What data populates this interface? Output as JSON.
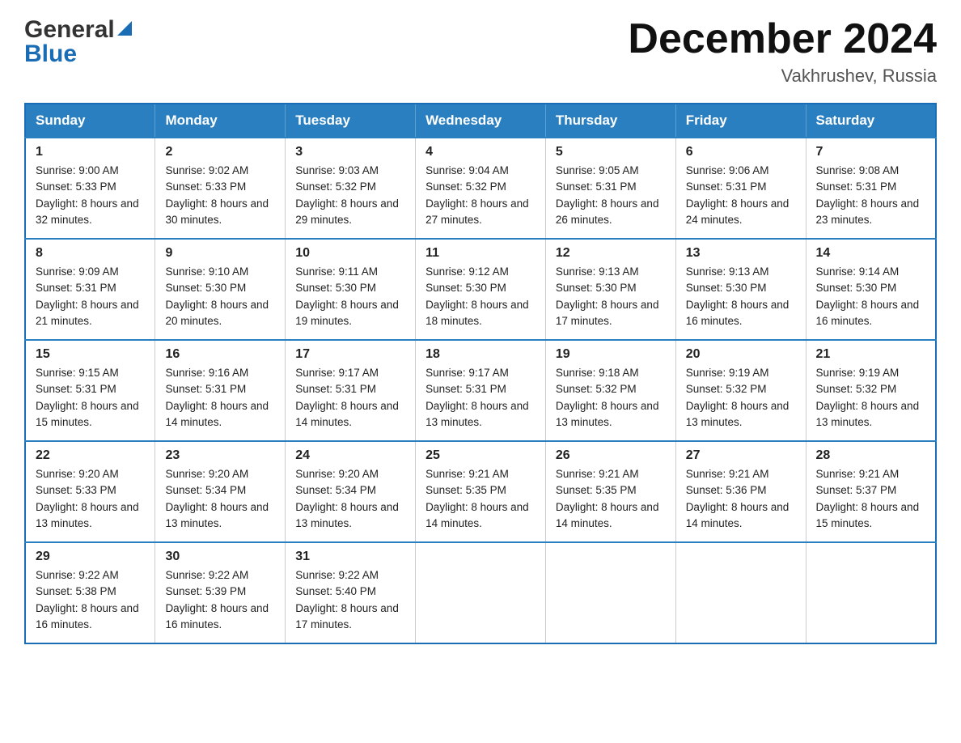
{
  "header": {
    "logo_general": "General",
    "logo_blue": "Blue",
    "title": "December 2024",
    "subtitle": "Vakhrushev, Russia"
  },
  "columns": [
    "Sunday",
    "Monday",
    "Tuesday",
    "Wednesday",
    "Thursday",
    "Friday",
    "Saturday"
  ],
  "weeks": [
    [
      {
        "day": "1",
        "sunrise": "Sunrise: 9:00 AM",
        "sunset": "Sunset: 5:33 PM",
        "daylight": "Daylight: 8 hours and 32 minutes."
      },
      {
        "day": "2",
        "sunrise": "Sunrise: 9:02 AM",
        "sunset": "Sunset: 5:33 PM",
        "daylight": "Daylight: 8 hours and 30 minutes."
      },
      {
        "day": "3",
        "sunrise": "Sunrise: 9:03 AM",
        "sunset": "Sunset: 5:32 PM",
        "daylight": "Daylight: 8 hours and 29 minutes."
      },
      {
        "day": "4",
        "sunrise": "Sunrise: 9:04 AM",
        "sunset": "Sunset: 5:32 PM",
        "daylight": "Daylight: 8 hours and 27 minutes."
      },
      {
        "day": "5",
        "sunrise": "Sunrise: 9:05 AM",
        "sunset": "Sunset: 5:31 PM",
        "daylight": "Daylight: 8 hours and 26 minutes."
      },
      {
        "day": "6",
        "sunrise": "Sunrise: 9:06 AM",
        "sunset": "Sunset: 5:31 PM",
        "daylight": "Daylight: 8 hours and 24 minutes."
      },
      {
        "day": "7",
        "sunrise": "Sunrise: 9:08 AM",
        "sunset": "Sunset: 5:31 PM",
        "daylight": "Daylight: 8 hours and 23 minutes."
      }
    ],
    [
      {
        "day": "8",
        "sunrise": "Sunrise: 9:09 AM",
        "sunset": "Sunset: 5:31 PM",
        "daylight": "Daylight: 8 hours and 21 minutes."
      },
      {
        "day": "9",
        "sunrise": "Sunrise: 9:10 AM",
        "sunset": "Sunset: 5:30 PM",
        "daylight": "Daylight: 8 hours and 20 minutes."
      },
      {
        "day": "10",
        "sunrise": "Sunrise: 9:11 AM",
        "sunset": "Sunset: 5:30 PM",
        "daylight": "Daylight: 8 hours and 19 minutes."
      },
      {
        "day": "11",
        "sunrise": "Sunrise: 9:12 AM",
        "sunset": "Sunset: 5:30 PM",
        "daylight": "Daylight: 8 hours and 18 minutes."
      },
      {
        "day": "12",
        "sunrise": "Sunrise: 9:13 AM",
        "sunset": "Sunset: 5:30 PM",
        "daylight": "Daylight: 8 hours and 17 minutes."
      },
      {
        "day": "13",
        "sunrise": "Sunrise: 9:13 AM",
        "sunset": "Sunset: 5:30 PM",
        "daylight": "Daylight: 8 hours and 16 minutes."
      },
      {
        "day": "14",
        "sunrise": "Sunrise: 9:14 AM",
        "sunset": "Sunset: 5:30 PM",
        "daylight": "Daylight: 8 hours and 16 minutes."
      }
    ],
    [
      {
        "day": "15",
        "sunrise": "Sunrise: 9:15 AM",
        "sunset": "Sunset: 5:31 PM",
        "daylight": "Daylight: 8 hours and 15 minutes."
      },
      {
        "day": "16",
        "sunrise": "Sunrise: 9:16 AM",
        "sunset": "Sunset: 5:31 PM",
        "daylight": "Daylight: 8 hours and 14 minutes."
      },
      {
        "day": "17",
        "sunrise": "Sunrise: 9:17 AM",
        "sunset": "Sunset: 5:31 PM",
        "daylight": "Daylight: 8 hours and 14 minutes."
      },
      {
        "day": "18",
        "sunrise": "Sunrise: 9:17 AM",
        "sunset": "Sunset: 5:31 PM",
        "daylight": "Daylight: 8 hours and 13 minutes."
      },
      {
        "day": "19",
        "sunrise": "Sunrise: 9:18 AM",
        "sunset": "Sunset: 5:32 PM",
        "daylight": "Daylight: 8 hours and 13 minutes."
      },
      {
        "day": "20",
        "sunrise": "Sunrise: 9:19 AM",
        "sunset": "Sunset: 5:32 PM",
        "daylight": "Daylight: 8 hours and 13 minutes."
      },
      {
        "day": "21",
        "sunrise": "Sunrise: 9:19 AM",
        "sunset": "Sunset: 5:32 PM",
        "daylight": "Daylight: 8 hours and 13 minutes."
      }
    ],
    [
      {
        "day": "22",
        "sunrise": "Sunrise: 9:20 AM",
        "sunset": "Sunset: 5:33 PM",
        "daylight": "Daylight: 8 hours and 13 minutes."
      },
      {
        "day": "23",
        "sunrise": "Sunrise: 9:20 AM",
        "sunset": "Sunset: 5:34 PM",
        "daylight": "Daylight: 8 hours and 13 minutes."
      },
      {
        "day": "24",
        "sunrise": "Sunrise: 9:20 AM",
        "sunset": "Sunset: 5:34 PM",
        "daylight": "Daylight: 8 hours and 13 minutes."
      },
      {
        "day": "25",
        "sunrise": "Sunrise: 9:21 AM",
        "sunset": "Sunset: 5:35 PM",
        "daylight": "Daylight: 8 hours and 14 minutes."
      },
      {
        "day": "26",
        "sunrise": "Sunrise: 9:21 AM",
        "sunset": "Sunset: 5:35 PM",
        "daylight": "Daylight: 8 hours and 14 minutes."
      },
      {
        "day": "27",
        "sunrise": "Sunrise: 9:21 AM",
        "sunset": "Sunset: 5:36 PM",
        "daylight": "Daylight: 8 hours and 14 minutes."
      },
      {
        "day": "28",
        "sunrise": "Sunrise: 9:21 AM",
        "sunset": "Sunset: 5:37 PM",
        "daylight": "Daylight: 8 hours and 15 minutes."
      }
    ],
    [
      {
        "day": "29",
        "sunrise": "Sunrise: 9:22 AM",
        "sunset": "Sunset: 5:38 PM",
        "daylight": "Daylight: 8 hours and 16 minutes."
      },
      {
        "day": "30",
        "sunrise": "Sunrise: 9:22 AM",
        "sunset": "Sunset: 5:39 PM",
        "daylight": "Daylight: 8 hours and 16 minutes."
      },
      {
        "day": "31",
        "sunrise": "Sunrise: 9:22 AM",
        "sunset": "Sunset: 5:40 PM",
        "daylight": "Daylight: 8 hours and 17 minutes."
      },
      null,
      null,
      null,
      null
    ]
  ]
}
